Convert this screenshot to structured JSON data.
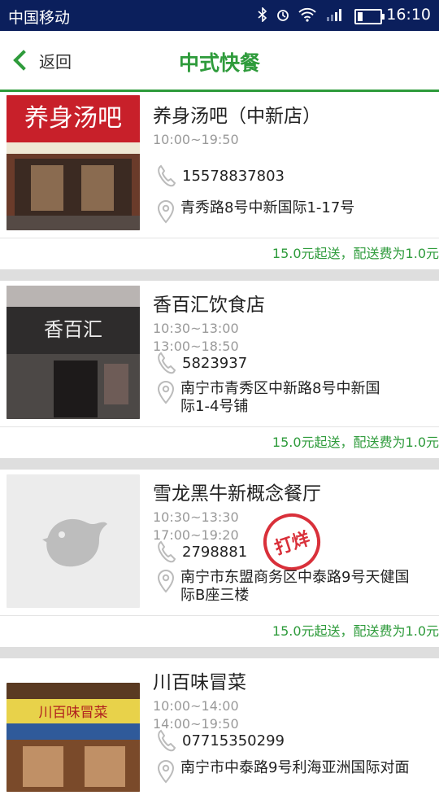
{
  "status_bar": {
    "carrier": "中国移动",
    "time": "16:10"
  },
  "nav": {
    "back_label": "返回",
    "title": "中式快餐"
  },
  "restaurants": [
    {
      "name": "养身汤吧（中新店）",
      "hours": [
        "10:00~19:50"
      ],
      "phone": "15578837803",
      "address": [
        "青秀路8号中新国际1-17号"
      ],
      "delivery": "15.0元起送，配送费为1.0元",
      "sign_text": "养身汤吧"
    },
    {
      "name": "香百汇饮食店",
      "hours": [
        "10:30~13:00",
        "13:00~18:50"
      ],
      "phone": "5823937",
      "address": [
        "南宁市青秀区中新路8号中新国",
        "际1-4号铺"
      ],
      "delivery": "15.0元起送，配送费为1.0元",
      "sign_text": "香百汇"
    },
    {
      "name": "雪龙黑牛新概念餐厅",
      "hours": [
        "10:30~13:30",
        "17:00~19:20"
      ],
      "phone": "2798881",
      "address": [
        "南宁市东盟商务区中泰路9号天健国",
        "际B座三楼"
      ],
      "delivery": "15.0元起送，配送费为1.0元",
      "stamp": "打烊"
    },
    {
      "name": "川百味冒菜",
      "hours": [
        "10:00~14:00",
        "14:00~19:50"
      ],
      "phone": "07715350299",
      "address": [
        "南宁市中泰路9号利海亚洲国际对面"
      ],
      "sign_text": "川百味冒菜"
    }
  ],
  "colors": {
    "accent": "#2e9b3b",
    "status_bg": "#0b1f5c",
    "stamp": "#d9303a"
  }
}
